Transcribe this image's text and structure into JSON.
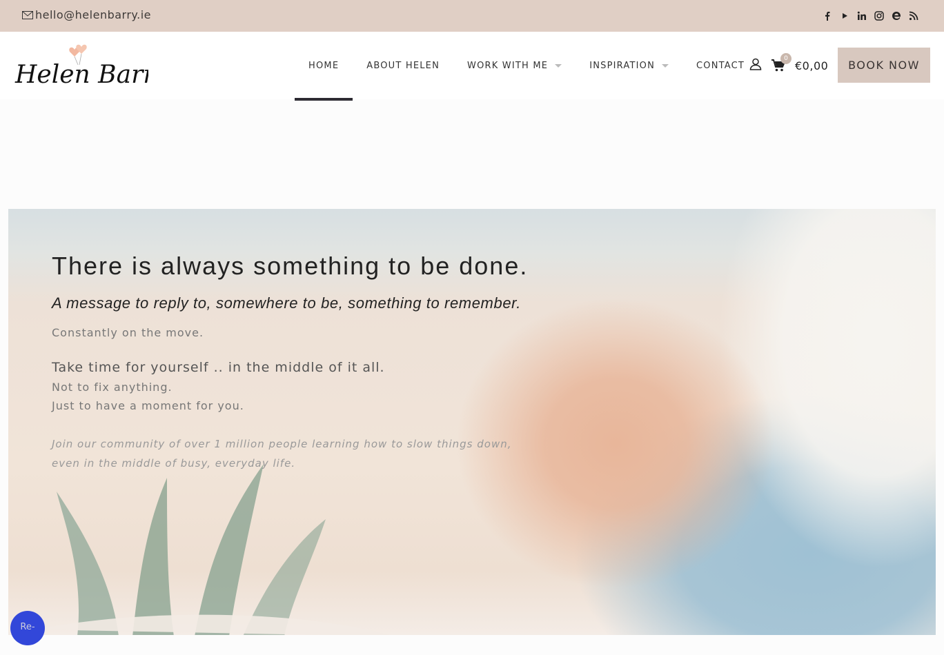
{
  "topbar": {
    "email": "hello@helenbarry.ie",
    "socials": [
      "facebook-icon",
      "youtube-icon",
      "linkedin-icon",
      "instagram-icon",
      "edge-icon",
      "rss-icon"
    ]
  },
  "header": {
    "logo_text": "Helen Barry",
    "nav": [
      {
        "label": "HOME",
        "active": true
      },
      {
        "label": "ABOUT HELEN"
      },
      {
        "label": "WORK WITH ME",
        "dropdown": true
      },
      {
        "label": "INSPIRATION",
        "dropdown": true
      },
      {
        "label": "CONTACT"
      }
    ],
    "cart_count": "0",
    "cart_total": "€0,00",
    "book_label": "BOOK NOW"
  },
  "hero": {
    "heading": "There is always something to be done.",
    "subheading": "A message to reply to, somewhere to be, something to remember.",
    "line1": "Constantly on the move.",
    "line2": "Take time for yourself .. in the middle of it all.",
    "line3": "Not to fix anything.",
    "line4": "Just to have a moment for you.",
    "line5": "Join our community of over 1 million people learning how to slow things down, even in the middle of busy, everyday life."
  },
  "chat": {
    "alt": "Re-"
  },
  "colors": {
    "topbar": "#e0cfc5",
    "book_button": "#d8c8bf",
    "active_underline": "#2d2b33",
    "chat": "#3247d9"
  }
}
